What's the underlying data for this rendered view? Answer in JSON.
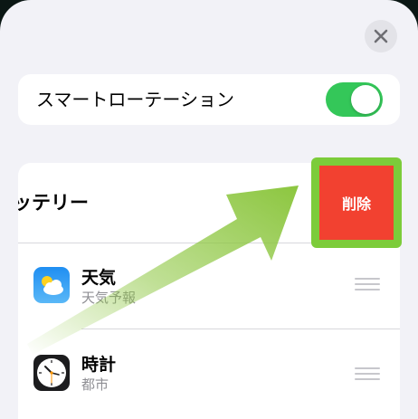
{
  "close_button": {
    "icon": "close-icon"
  },
  "rotation": {
    "label": "スマートローテーション",
    "enabled": true,
    "color": "#34c759"
  },
  "widgets": {
    "swiped_item_label": "ッテリー",
    "delete_label": "削除",
    "delete_color": "#f24130",
    "highlight_color": "#7ccc3a",
    "items": [
      {
        "title": "天気",
        "subtitle": "天気予報",
        "icon": "weather-icon"
      },
      {
        "title": "時計",
        "subtitle": "都市",
        "icon": "clock-icon"
      }
    ]
  },
  "annotation": {
    "icon": "swipe-arrow-icon",
    "color": "#8cc63f"
  }
}
